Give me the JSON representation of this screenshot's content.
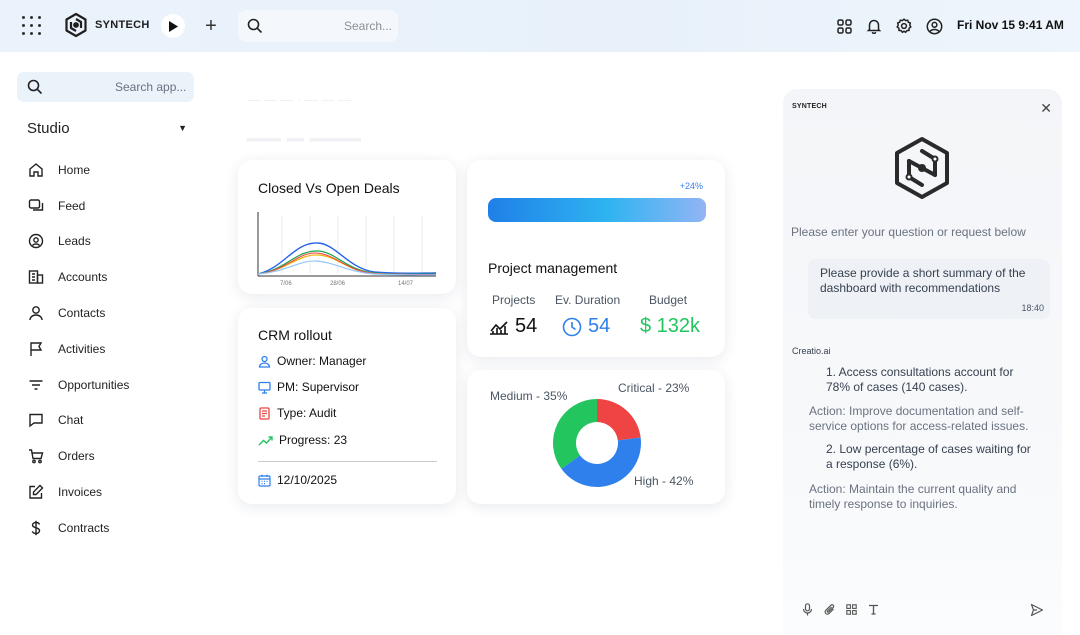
{
  "topbar": {
    "brand": "SYNTECH",
    "search_placeholder": "Search...",
    "datetime": "Fri Nov 15  9:41 AM",
    "icons": [
      "apps-grid-icon",
      "logo-icon",
      "play-icon",
      "plus-icon",
      "search-icon",
      "widgets-icon",
      "bell-icon",
      "gear-icon",
      "user-circle-icon"
    ]
  },
  "sidebar": {
    "search_placeholder": "Search app...",
    "workspace": "Studio",
    "items": [
      {
        "label": "Home",
        "icon": "home-icon"
      },
      {
        "label": "Feed",
        "icon": "feed-icon"
      },
      {
        "label": "Leads",
        "icon": "leads-icon"
      },
      {
        "label": "Accounts",
        "icon": "accounts-icon"
      },
      {
        "label": "Contacts",
        "icon": "contacts-icon"
      },
      {
        "label": "Activities",
        "icon": "flag-icon"
      },
      {
        "label": "Opportunities",
        "icon": "filter-icon"
      },
      {
        "label": "Chat",
        "icon": "chat-icon"
      },
      {
        "label": "Orders",
        "icon": "cart-icon"
      },
      {
        "label": "Invoices",
        "icon": "edit-icon"
      },
      {
        "label": "Contracts",
        "icon": "dollar-icon"
      }
    ]
  },
  "deals_card": {
    "title": "Closed Vs Open Deals",
    "x_ticks": [
      "7/06",
      "28/06",
      "14/07"
    ],
    "series_colors": [
      "#2563eb",
      "#16a34a",
      "#eab308",
      "#ef4444",
      "#93c5fd"
    ]
  },
  "crm_card": {
    "title": "CRM rollout",
    "owner_label": "Owner:",
    "owner_value": "Manager",
    "pm_label": "PM:",
    "pm_value": "Supervisor",
    "type_label": "Type:",
    "type_value": "Audit",
    "progress_label": "Progress:",
    "progress_value": "23",
    "date": "12/10/2025"
  },
  "pm_card": {
    "percent": "+24%",
    "title": "Project management",
    "projects_label": "Projects",
    "projects_value": "54",
    "duration_label": "Ev. Duration",
    "duration_value": "54",
    "budget_label": "Budget",
    "budget_value": "$ 132k"
  },
  "donut_card": {
    "medium_label": "Medium - 35%",
    "critical_label": "Critical - 23%",
    "high_label": "High - 42%",
    "colors": {
      "medium": "#22c55e",
      "critical": "#ef4444",
      "high": "#2f80ed"
    }
  },
  "chat": {
    "brand": "SYNTECH",
    "prompt": "Please enter your question or request below",
    "user_message": "Please provide a short summary of the dashboard with recommendations",
    "user_time": "18:40",
    "ai_name": "Creatio.ai",
    "item1": "1. Access consultations account for 78% of cases (140 cases).",
    "action1_label": "Action:",
    "action1": "Improve documentation and self-service options for access-related issues.",
    "item2": "2. Low percentage of cases waiting for a response (6%).",
    "action2_label": "Action:",
    "action2": "Maintain the current quality and timely response to inquiries."
  },
  "chart_data": {
    "type": "pie",
    "categories": [
      "Medium",
      "Critical",
      "High"
    ],
    "values": [
      35,
      23,
      42
    ]
  }
}
